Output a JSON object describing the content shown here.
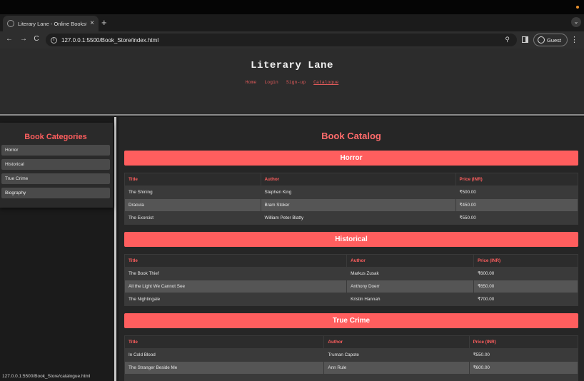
{
  "browser": {
    "tab_title": "Literary Lane - Online Booksto",
    "tab_close": "×",
    "new_tab": "+",
    "tab_menu": "⌄",
    "back": "←",
    "forward": "→",
    "reload": "C",
    "url": "127.0.0.1:5500/Book_Store/index.html",
    "zoom_icon": "⚲",
    "profile_label": "Guest",
    "menu": "⋮",
    "status_url": "127.0.0.1:5500/Book_Store/catalogue.html"
  },
  "site": {
    "title": "Literary Lane",
    "nav": [
      "Home",
      "Login",
      "Sign-up",
      "Catalogue"
    ]
  },
  "sidebar": {
    "heading": "Book Categories",
    "items": [
      "Horror",
      "Historical",
      "True Crime",
      "Biography"
    ]
  },
  "catalog": {
    "title": "Book Catalog",
    "columns": [
      "Title",
      "Author",
      "Price (INR)"
    ],
    "sections": [
      {
        "name": "Horror",
        "rows": [
          [
            "The Shining",
            "Stephen King",
            "₹500.00"
          ],
          [
            "Dracula",
            "Bram Stoker",
            "₹450.00"
          ],
          [
            "The Exorcist",
            "William Peter Blatty",
            "₹550.00"
          ]
        ]
      },
      {
        "name": "Historical",
        "rows": [
          [
            "The Book Thief",
            "Markus Zusak",
            "₹600.00"
          ],
          [
            "All the Light We Cannot See",
            "Anthony Doerr",
            "₹650.00"
          ],
          [
            "The Nightingale",
            "Kristin Hannah",
            "₹700.00"
          ]
        ]
      },
      {
        "name": "True Crime",
        "rows": [
          [
            "In Cold Blood",
            "Truman Capote",
            "₹550.00"
          ],
          [
            "The Stranger Beside Me",
            "Ann Rule",
            "₹600.00"
          ],
          [
            "",
            "",
            ""
          ]
        ]
      }
    ]
  }
}
